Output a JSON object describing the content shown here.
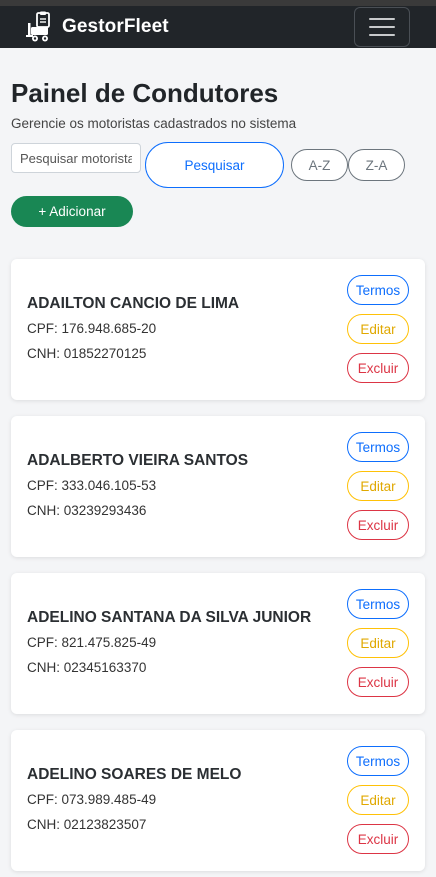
{
  "navbar": {
    "brand": "GestorFleet",
    "brand_icon": "forklift-clipboard-icon",
    "menu_icon": "hamburger-menu-icon"
  },
  "header": {
    "title": "Painel de Condutores",
    "subtitle": "Gerencie os motoristas cadastrados no sistema"
  },
  "toolbar": {
    "search_placeholder": "Pesquisar motorista",
    "search_label": "Pesquisar",
    "sort_az_label": "A-Z",
    "sort_za_label": "Z-A",
    "add_label": "+ Adicionar"
  },
  "drivers": [
    {
      "name": "ADAILTON CANCIO DE LIMA",
      "cpf": "CPF: 176.948.685-20",
      "cnh": "CNH: 01852270125"
    },
    {
      "name": "ADALBERTO VIEIRA SANTOS",
      "cpf": "CPF: 333.046.105-53",
      "cnh": "CNH: 03239293436"
    },
    {
      "name": "ADELINO SANTANA DA SILVA JUNIOR",
      "cpf": "CPF: 821.475.825-49",
      "cnh": "CNH: 02345163370"
    },
    {
      "name": "ADELINO SOARES DE MELO",
      "cpf": "CPF: 073.989.485-49",
      "cnh": "CNH: 02123823507"
    }
  ],
  "card_actions": {
    "termos": "Termos",
    "editar": "Editar",
    "excluir": "Excluir"
  },
  "colors": {
    "navbar": "#212529",
    "primary": "#0d6efd",
    "success": "#198754",
    "warning": "#ffc107",
    "danger": "#dc3545",
    "secondary": "#6c757d"
  }
}
